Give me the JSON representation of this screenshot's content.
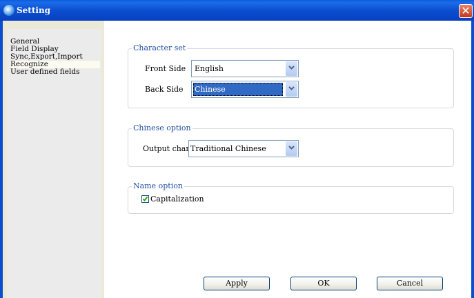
{
  "window": {
    "title": "Setting",
    "close_glyph": "✕"
  },
  "sidebar": {
    "items": [
      {
        "label": "General"
      },
      {
        "label": "Field Display"
      },
      {
        "label": "Sync,Export,Import"
      },
      {
        "label": "Recognize",
        "selected": true
      },
      {
        "label": "User defined fields"
      }
    ]
  },
  "character_set": {
    "title": "Character set",
    "front_side": {
      "label": "Front Side",
      "value": "English"
    },
    "back_side": {
      "label": "Back Side",
      "value": "Chinese"
    }
  },
  "chinese_option": {
    "title": "Chinese option",
    "output": {
      "label": "Output characte",
      "value": "Traditional Chinese"
    }
  },
  "name_option": {
    "title": "Name option",
    "capitalization": {
      "label": "Capitalization",
      "checked": true
    }
  },
  "buttons": {
    "apply": "Apply",
    "ok": "OK",
    "cancel": "Cancel"
  },
  "colors": {
    "titlebar": "#0a4fd0",
    "group_title": "#1f4da1",
    "selection": "#316ac5",
    "close": "#c1381e"
  }
}
